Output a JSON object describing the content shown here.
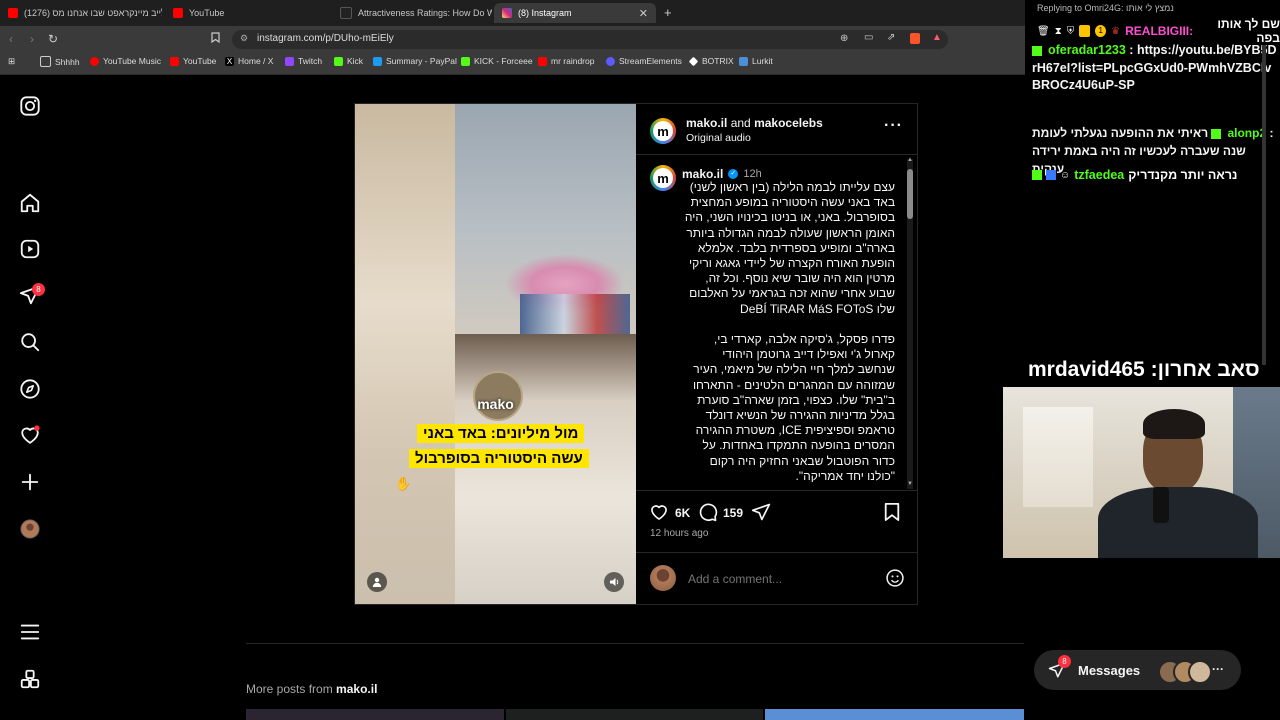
{
  "browser": {
    "tabs": [
      {
        "title": "(1276) לייב מיינקראפט שבו אנחנו מס",
        "color": "#ff0000",
        "active": false
      },
      {
        "title": "YouTube",
        "color": "#ff0000",
        "active": false
      },
      {
        "title": "Attractiveness Ratings: How Do We M",
        "color": "#111111",
        "active": false
      },
      {
        "title": "(8) Instagram",
        "color": "#d62976",
        "active": true
      }
    ],
    "new_tab": "+",
    "url": "instagram.com/p/DUho-mEiEly",
    "bookmarks": [
      {
        "label": "Shhhh",
        "color": "#cccccc"
      },
      {
        "label": "YouTube Music",
        "color": "#ff0000"
      },
      {
        "label": "YouTube",
        "color": "#ff0000"
      },
      {
        "label": "Home / X",
        "color": "#ffffff"
      },
      {
        "label": "Twitch",
        "color": "#9146ff"
      },
      {
        "label": "Kick",
        "color": "#53fc18"
      },
      {
        "label": "Summary - PayPal",
        "color": "#1d9bf0"
      },
      {
        "label": "KICK - Forceee",
        "color": "#53fc18"
      },
      {
        "label": "mr raindrop",
        "color": "#ff0000"
      },
      {
        "label": "StreamElements",
        "color": "#5b5bff"
      },
      {
        "label": "BOTRIX",
        "color": "#ffffff"
      },
      {
        "label": "Lurkit",
        "color": "#4a90d9"
      }
    ]
  },
  "sidebar": {
    "notification_count": "8",
    "items": [
      "instagram-logo",
      "home",
      "reels",
      "direct",
      "search",
      "explore",
      "notifications",
      "create",
      "profile",
      "more",
      "also-from-meta"
    ]
  },
  "post": {
    "header_author": "mako.il",
    "header_and": "and",
    "header_coauthor": "makocelebs",
    "audio": "Original audio",
    "caption_author": "mako.il",
    "time_ago": "12h",
    "caption": "עצם עלייתו לבמה הלילה (בין ראשון לשני) באד באני עשה היסטוריה במופע המחצית בסופרבול. באני, או בניטו בכינויו השני, היה האומן הראשון שעולה לבמה הגדולה ביותר בארה\"ב ומופיע בספרדית בלבד. אלמלא הופעת האורח הקצרה של ליידי גאגא וריקי מרטין הוא היה שובר שיא נוסף. וכל זה, שבוע אחרי שהוא זכה בגראמי על האלבום שלו DeBÍ TiRAR MáS FOToS\n\nפדרו פסקל, ג'סיקה אלבה, קארדי בי, קארול ג'י ואפילו דייב גרוטמן היהודי שנחשב למלך חיי הלילה של מיאמי, העיר שמזוהה עם המהגרים הלטינים - התארחו ב\"בית\" שלו. כצפוי, בזמן שארה\"ב סוערת בגלל מדיניות ההגירה של הנשיא דונלד טראמפ וספיציפית ICE, משטרת ההגירה המסרים בהופעה התמקדו באחדות. על כדור הפוטבול שבאני החזיק היה רקום \"כולנו יחד אמריקה\".",
    "likes": "6K",
    "comments": "159",
    "posted": "12 hours ago",
    "comment_placeholder": "Add a comment...",
    "video_brand": "mako",
    "video_text_line1": "מול מיליונים: באד באני",
    "video_text_line2": "עשה היסטוריה בסופרבול",
    "more_posts_prefix": "More posts from",
    "more_posts_author": "mako.il"
  },
  "stream": {
    "reply_header": "Replying to Omri24G: נמצץ לי אותו",
    "reply_user": "REALBIGIII:",
    "reply_text": "שם לך אותו בפה",
    "chat": [
      {
        "user": "oferadar1233",
        "color": "#53fc18",
        "text": "https://youtu.be/BYB5DrH67eI?list=PLpcGGxUd0-PWmhVZBClvBROCz4U6uP-SP"
      },
      {
        "user": "alonp2",
        "color": "#53fc18",
        "text": "ראיתי את ההופעה נגעלתי לעומת שנה שעברה לעכשיו זה היה באמת ירידה ענקית"
      },
      {
        "user": "tzfaedea",
        "color": "#53fc18",
        "text": "נראה יותר מקנדריק"
      }
    ],
    "sub_label": "סאב אחרון:",
    "sub_user": "mrdavid465"
  },
  "messages": {
    "label": "Messages",
    "count": "8"
  }
}
